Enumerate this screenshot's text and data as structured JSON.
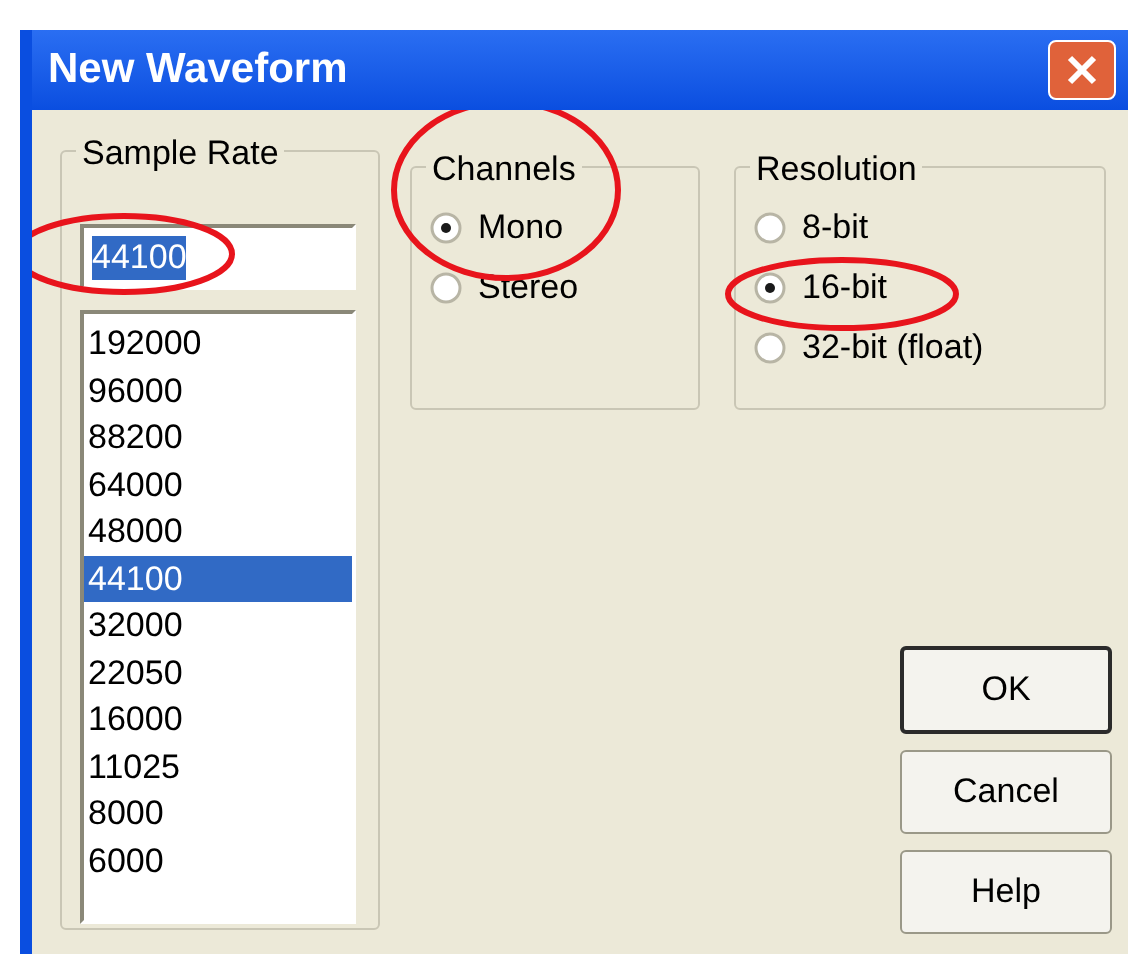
{
  "window": {
    "title": "New Waveform"
  },
  "sample_rate": {
    "label": "Sample Rate",
    "value": "44100",
    "options": [
      {
        "label": "192000",
        "selected": false
      },
      {
        "label": "96000",
        "selected": false
      },
      {
        "label": "88200",
        "selected": false
      },
      {
        "label": "64000",
        "selected": false
      },
      {
        "label": "48000",
        "selected": false
      },
      {
        "label": "44100",
        "selected": true
      },
      {
        "label": "32000",
        "selected": false
      },
      {
        "label": "22050",
        "selected": false
      },
      {
        "label": "16000",
        "selected": false
      },
      {
        "label": "11025",
        "selected": false
      },
      {
        "label": "8000",
        "selected": false
      },
      {
        "label": "6000",
        "selected": false
      }
    ]
  },
  "channels": {
    "label": "Channels",
    "options": [
      {
        "label": "Mono",
        "selected": true
      },
      {
        "label": "Stereo",
        "selected": false
      }
    ]
  },
  "resolution": {
    "label": "Resolution",
    "options": [
      {
        "label": "8-bit",
        "selected": false
      },
      {
        "label": "16-bit",
        "selected": true
      },
      {
        "label": "32-bit (float)",
        "selected": false
      }
    ]
  },
  "buttons": [
    {
      "label": "OK",
      "default": true
    },
    {
      "label": "Cancel",
      "default": false
    },
    {
      "label": "Help",
      "default": false
    }
  ]
}
